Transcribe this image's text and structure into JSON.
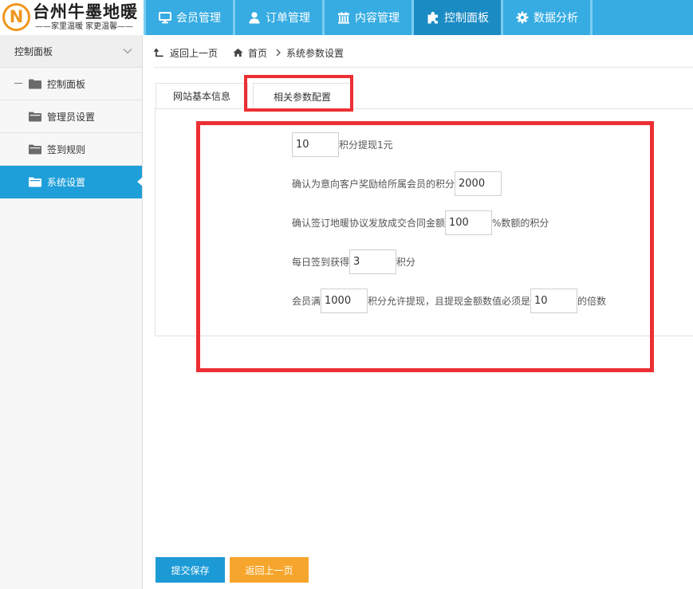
{
  "logo": {
    "mark": "N",
    "title": "台州牛墨地暖",
    "subtitle": "——家里温暖 家更温馨——"
  },
  "nav": {
    "items": [
      {
        "label": "会员管理",
        "icon": "monitor-icon",
        "active": false
      },
      {
        "label": "订单管理",
        "icon": "user-icon",
        "active": false
      },
      {
        "label": "内容管理",
        "icon": "building-icon",
        "active": false
      },
      {
        "label": "控制面板",
        "icon": "puzzle-icon",
        "active": true
      },
      {
        "label": "数据分析",
        "icon": "gear-icon",
        "active": false
      }
    ]
  },
  "sidebar": {
    "header": "控制面板",
    "header_icon": "chevron-down-icon",
    "root": {
      "label": "控制面板",
      "icon": "folder-icon",
      "expanded": true
    },
    "items": [
      {
        "label": "管理员设置",
        "icon": "folder-open-icon",
        "active": false
      },
      {
        "label": "签到规则",
        "icon": "folder-open-icon",
        "active": false
      },
      {
        "label": "系统设置",
        "icon": "folder-open-icon",
        "active": true
      }
    ]
  },
  "breadcrumb": {
    "back": "返回上一页",
    "home": "首页",
    "current": "系统参数设置"
  },
  "tabs": [
    {
      "label": "网站基本信息",
      "active": false
    },
    {
      "label": "相关参数配置",
      "active": true
    }
  ],
  "form": {
    "withdraw_rate": {
      "value": "10",
      "suffix": "积分提现1元"
    },
    "intent_reward": {
      "label": "确认为意向客户奖励给所属会员的积分",
      "value": "2000"
    },
    "contract_reward": {
      "label": "确认签订地暖协议发放成交合同金额",
      "value": "100",
      "suffix": "%数额的积分"
    },
    "daily_checkin": {
      "label": "每日签到获得",
      "value": "3",
      "suffix": "积分"
    },
    "withdraw_rule": {
      "label": "会员满",
      "min_points": "1000",
      "middle": "积分允许提现，且提现金额数值必须是",
      "multiple": "10",
      "suffix": "的倍数"
    }
  },
  "buttons": {
    "submit": "提交保存",
    "back": "返回上一页"
  },
  "colors": {
    "nav": "#36ace2",
    "nav_active": "#1b8bc4",
    "accent": "#1e9fd9",
    "submit": "#1c9ad6",
    "back": "#f7a62d",
    "highlight": "#ec2f33",
    "logo": "#f0961c"
  }
}
